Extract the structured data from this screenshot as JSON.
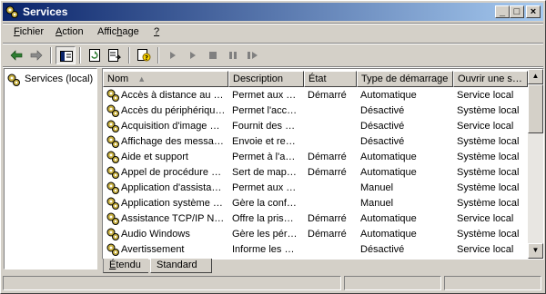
{
  "window": {
    "title": "Services"
  },
  "title_buttons": {
    "minimize": "_",
    "maximize": "□",
    "close": "×"
  },
  "menu": [
    {
      "label": "Fichier",
      "accel": "F",
      "rest": "ichier"
    },
    {
      "label": "Action",
      "accel": "A",
      "rest": "ction"
    },
    {
      "label": "Affichage",
      "pre": "Affic",
      "accel": "h",
      "post": "age"
    },
    {
      "label": "?",
      "accel": "?",
      "rest": ""
    }
  ],
  "toolbar": {
    "icons": [
      "back-arrow-icon",
      "forward-arrow-icon",
      "show-hide-tree-icon",
      "refresh-icon",
      "export-list-icon",
      "properties-help-icon",
      "play-icon",
      "play-alt-icon",
      "stop-icon",
      "pause-icon",
      "restart-icon"
    ]
  },
  "tree": {
    "root_label": "Services (local)"
  },
  "columns": [
    "Nom",
    "Description",
    "État",
    "Type de démarrage",
    "Ouvrir une s…"
  ],
  "sort_indicator": "▲",
  "services": [
    {
      "name": "Accès à distance au …",
      "description": "Permet aux …",
      "state": "Démarré",
      "startup": "Automatique",
      "logon": "Service local"
    },
    {
      "name": "Accès du périphériqu…",
      "description": "Permet l'acc…",
      "state": "",
      "startup": "Désactivé",
      "logon": "Système local"
    },
    {
      "name": "Acquisition d'image …",
      "description": "Fournit des …",
      "state": "",
      "startup": "Désactivé",
      "logon": "Service local"
    },
    {
      "name": "Affichage des messa…",
      "description": "Envoie et re…",
      "state": "",
      "startup": "Désactivé",
      "logon": "Système local"
    },
    {
      "name": "Aide et support",
      "description": "Permet à l'a…",
      "state": "Démarré",
      "startup": "Automatique",
      "logon": "Système local"
    },
    {
      "name": "Appel de procédure …",
      "description": "Sert de map…",
      "state": "Démarré",
      "startup": "Automatique",
      "logon": "Système local"
    },
    {
      "name": "Application d'assista…",
      "description": "Permet aux …",
      "state": "",
      "startup": "Manuel",
      "logon": "Système local"
    },
    {
      "name": "Application système …",
      "description": "Gère la conf…",
      "state": "",
      "startup": "Manuel",
      "logon": "Système local"
    },
    {
      "name": "Assistance TCP/IP N…",
      "description": "Offre la pris…",
      "state": "Démarré",
      "startup": "Automatique",
      "logon": "Service local"
    },
    {
      "name": "Audio Windows",
      "description": "Gère les pér…",
      "state": "Démarré",
      "startup": "Automatique",
      "logon": "Système local"
    },
    {
      "name": "Avertissement",
      "description": "Informe les …",
      "state": "",
      "startup": "Désactivé",
      "logon": "Service local"
    }
  ],
  "scrollbar": {
    "up": "▲",
    "down": "▼"
  },
  "tabs": [
    {
      "label": "Étendu",
      "pre": "",
      "accel": "É",
      "post": "tendu",
      "active": false
    },
    {
      "label": "Standard",
      "pre": "",
      "accel": "",
      "post": "Standard",
      "active": true
    }
  ]
}
